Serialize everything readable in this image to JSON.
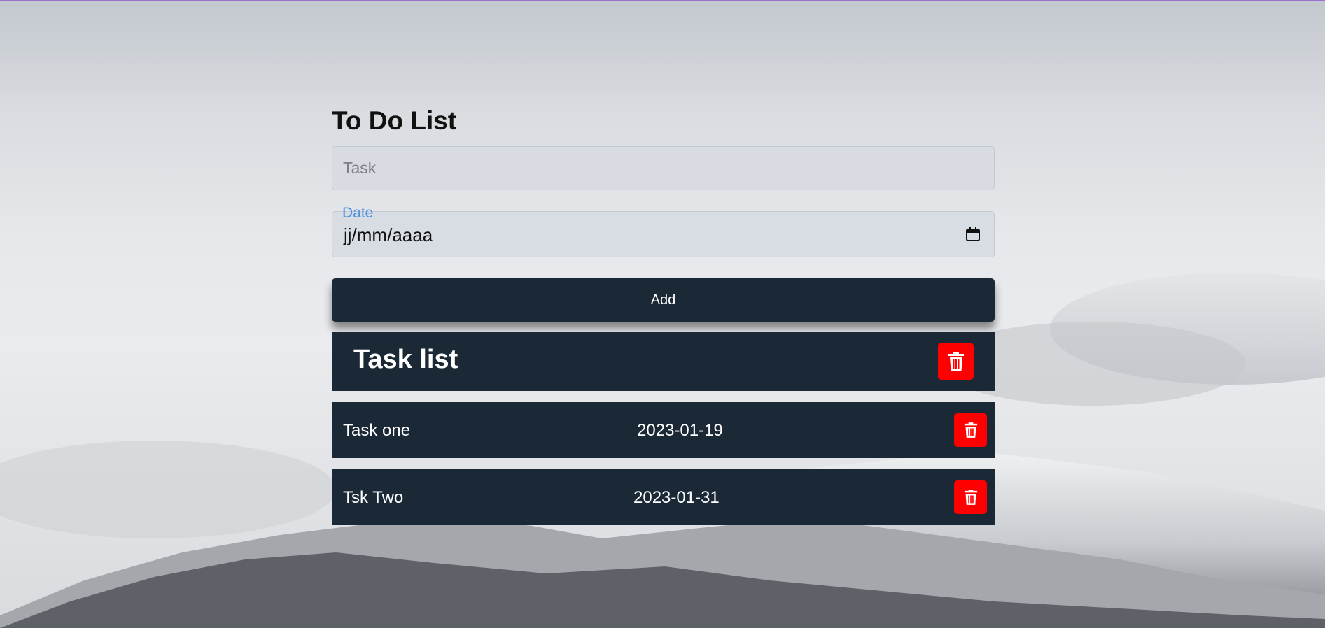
{
  "app": {
    "title": "To Do List"
  },
  "form": {
    "task_placeholder": "Task",
    "date_label": "Date",
    "date_value": "jj/mm/aaaa",
    "add_label": "Add"
  },
  "list": {
    "title": "Task list",
    "tasks": [
      {
        "name": "Task one",
        "date": "2023-01-19"
      },
      {
        "name": "Tsk Two",
        "date": "2023-01-31"
      }
    ]
  },
  "colors": {
    "panel": "#1b2937",
    "delete": "#ff0000",
    "label_accent": "#4a8fe2"
  },
  "icons": [
    "calendar-icon",
    "trash-icon"
  ]
}
